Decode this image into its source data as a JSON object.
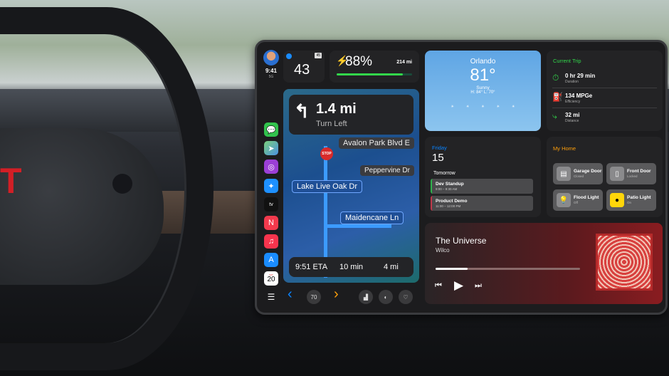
{
  "status": {
    "time": "9:41",
    "signal": "5G"
  },
  "speed": {
    "current": "43",
    "limit": "45"
  },
  "battery": {
    "percent": "88%",
    "range": "214 mi",
    "level": 0.88
  },
  "nav": {
    "distance": "1.4 mi",
    "instruction": "Turn Left",
    "streets": [
      "Avalon Park Blvd E",
      "Peppervine Dr",
      "Lake Live Oak Dr",
      "Maidencane Ln"
    ],
    "eta": "9:51 ETA",
    "duration": "10 min",
    "remaining": "4 mi"
  },
  "sidebar": {
    "apps": [
      "messages",
      "maps",
      "podcasts",
      "safari",
      "tv",
      "news",
      "music",
      "app-store",
      "calendar"
    ],
    "tv_label": "tv",
    "calendar_day": "20",
    "calendar_month": "SAT"
  },
  "controls": {
    "back": "‹",
    "temp": "70",
    "forward": "›"
  },
  "weather": {
    "city": "Orlando",
    "temp": "81°",
    "condition": "Sunny",
    "hilo": "H: 84° L: 70°"
  },
  "trip": {
    "title": "Current Trip",
    "rows": [
      {
        "value": "0 hr 29 min",
        "label": "Duration"
      },
      {
        "value": "134 MPGe",
        "label": "Efficiency"
      },
      {
        "value": "32 mi",
        "label": "Distance"
      }
    ]
  },
  "calendar": {
    "weekday": "Friday",
    "day": "15",
    "section": "Tomorrow",
    "events": [
      {
        "title": "Dev Standup",
        "time": "9:00 – 9:30 AM",
        "color": "#2fb24c"
      },
      {
        "title": "Product Demo",
        "time": "11:00 – 12:00 PM",
        "color": "#c0394a"
      }
    ]
  },
  "home": {
    "title": "My Home",
    "accessories": [
      {
        "name": "Garage Door",
        "status": "Closed"
      },
      {
        "name": "Front Door",
        "status": "Locked"
      },
      {
        "name": "Flood Light",
        "status": "Off"
      },
      {
        "name": "Patio Light",
        "status": "On"
      }
    ]
  },
  "music": {
    "title": "The Universe",
    "artist": "Wilco",
    "progress": 0.22
  },
  "colors": {
    "green": "#32d74b",
    "blue": "#0a84ff",
    "orange": "#ff9f0a",
    "yellow": "#ffd60a"
  }
}
